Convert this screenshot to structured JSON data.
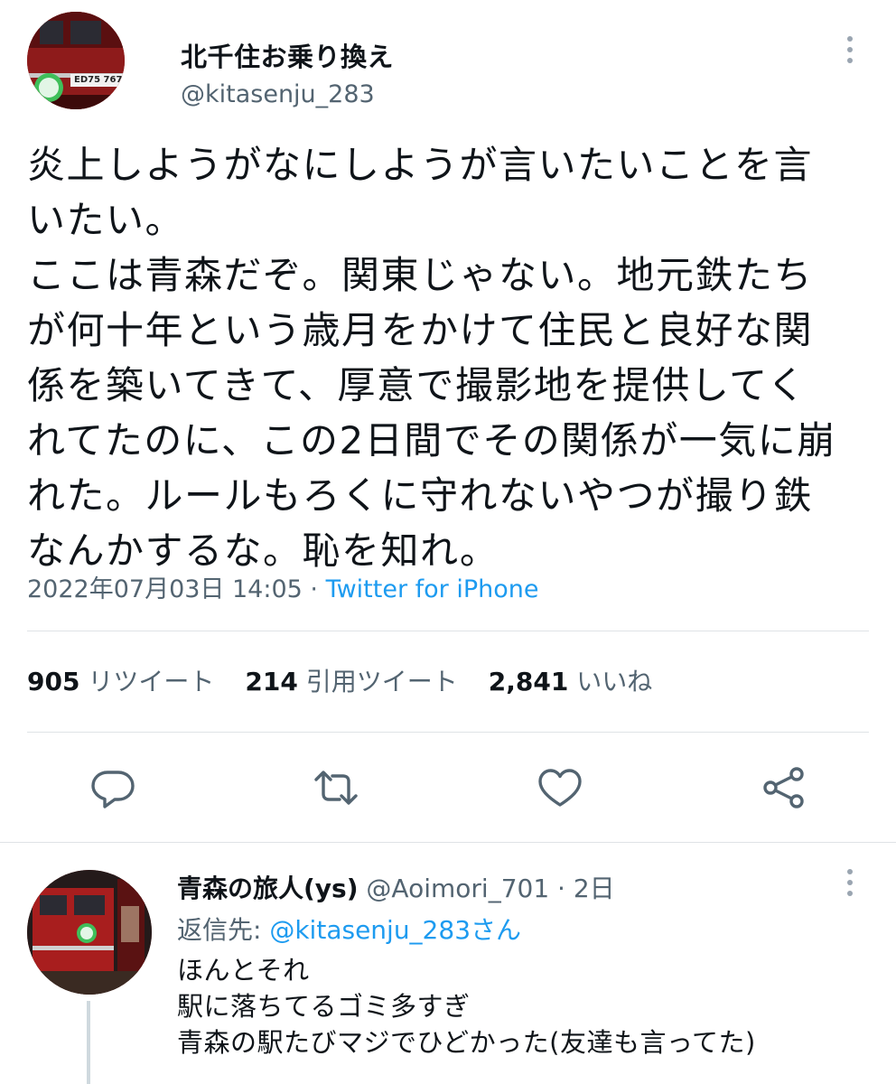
{
  "tweet": {
    "display_name": "北千住お乗り換え",
    "handle": "@kitasenju_283",
    "text": "炎上しようがなにしようが言いたいことを言\nいたい。\nここは青森だぞ。関東じゃない。地元鉄たち\nが何十年という歳月をかけて住民と良好な関\n係を築いてきて、厚意で撮影地を提供してく\nれてたのに、この2日間でその関係が一気に崩\nれた。ルールもろくに守れないやつが撮り鉄\nなんかするな。恥を知れ。",
    "timestamp": "2022年07月03日 14:05",
    "separator": " · ",
    "source": "Twitter for iPhone",
    "avatar_text": "ED75 767",
    "stats": {
      "retweets": "905",
      "retweets_label": "リツイート",
      "quotes": "214",
      "quotes_label": "引用ツイート",
      "likes": "2,841",
      "likes_label": "いいね"
    },
    "actions": [
      "reply-icon",
      "retweet-icon",
      "like-icon",
      "share-icon"
    ]
  },
  "reply": {
    "display_name": "青森の旅人(ys)",
    "handle": "@Aoimori_701",
    "separator": " · ",
    "time": "2日",
    "replying_to_label": "返信先: ",
    "replying_to": "@kitasenju_283さん",
    "text": "ほんとそれ\n駅に落ちてるゴミ多すぎ\n青森の駅たびマジでひどかった(友達も言ってた)"
  },
  "colors": {
    "text": "#0f1419",
    "secondary": "#536471",
    "accent": "#1d9bf0",
    "divider": "#dfe3e6"
  }
}
